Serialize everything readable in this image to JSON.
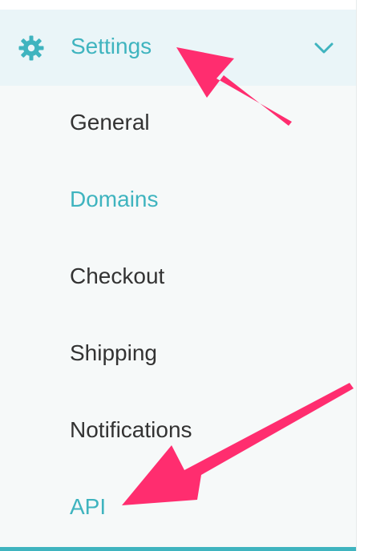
{
  "settings": {
    "label": "Settings",
    "icon": "gear-icon",
    "expand_icon": "chevron-down-icon"
  },
  "menu": {
    "items": [
      {
        "label": "General",
        "active": false
      },
      {
        "label": "Domains",
        "active": true
      },
      {
        "label": "Checkout",
        "active": false
      },
      {
        "label": "Shipping",
        "active": false
      },
      {
        "label": "Notifications",
        "active": false
      },
      {
        "label": "API",
        "active": true
      }
    ]
  },
  "colors": {
    "accent": "#3fb4bf",
    "text": "#333333",
    "header_background": "#eaf5f8",
    "sidebar_background": "#f6f9f9",
    "annotation_arrow": "#ff2d6f"
  }
}
